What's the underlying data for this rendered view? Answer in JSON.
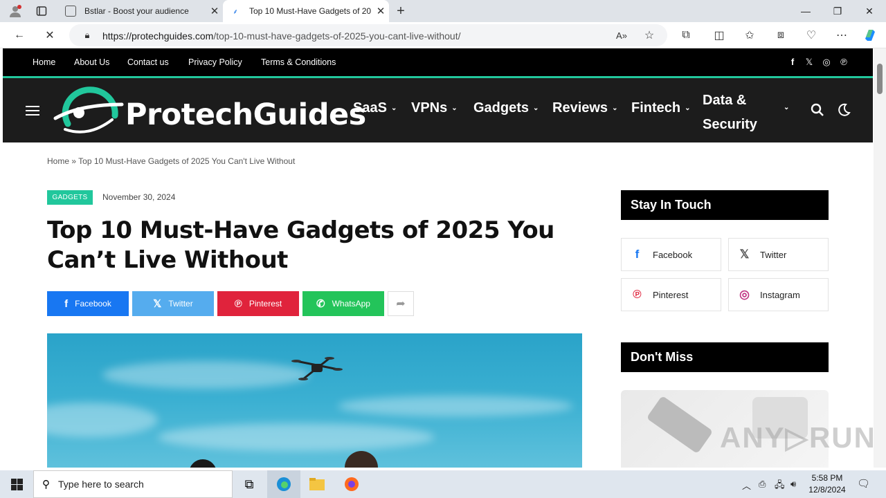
{
  "browser": {
    "tabs": [
      {
        "title": "Bstlar - Boost your audience",
        "active": false
      },
      {
        "title": "Top 10 Must-Have Gadgets of 20",
        "active": true
      }
    ],
    "new_tab": "+",
    "url_domain": "https://protechguides.com",
    "url_path": "/top-10-must-have-gadgets-of-2025-you-cant-live-without/"
  },
  "topbar": {
    "links": [
      "Home",
      "About Us",
      "Contact us",
      "Privacy Policy",
      "Terms & Conditions"
    ],
    "social": [
      "f",
      "𝕏",
      "◎",
      "℗"
    ]
  },
  "header": {
    "logo": "ProtechGuides",
    "nav": [
      "SaaS",
      "VPNs",
      "Gadgets",
      "Reviews",
      "Fintech",
      "Data &",
      "Security"
    ]
  },
  "article": {
    "breadcrumb_home": "Home",
    "breadcrumb_sep": " » ",
    "breadcrumb_current": "Top 10 Must-Have Gadgets of 2025 You Can't Live Without",
    "category": "GADGETS",
    "date": "November 30, 2024",
    "title": "Top 10 Must-Have Gadgets of 2025 You Can’t Live Without",
    "share": [
      {
        "label": "Facebook",
        "color": "#1877f2"
      },
      {
        "label": "Twitter",
        "color": "#55acee"
      },
      {
        "label": "Pinterest",
        "color": "#e0233c"
      },
      {
        "label": "WhatsApp",
        "color": "#23c45a"
      }
    ]
  },
  "sidebar": {
    "stay_title": "Stay In Touch",
    "socials": [
      {
        "label": "Facebook",
        "icon": "f",
        "color": "#1877f2"
      },
      {
        "label": "Twitter",
        "icon": "𝕏",
        "color": "#555"
      },
      {
        "label": "Pinterest",
        "icon": "℗",
        "color": "#e0233c"
      },
      {
        "label": "Instagram",
        "icon": "◎",
        "color": "#c13584"
      }
    ],
    "dontmiss_title": "Don't Miss"
  },
  "watermark": "ANY▷RUN",
  "taskbar": {
    "search_placeholder": "Type here to search",
    "time": "5:58 PM",
    "date": "12/8/2024"
  }
}
